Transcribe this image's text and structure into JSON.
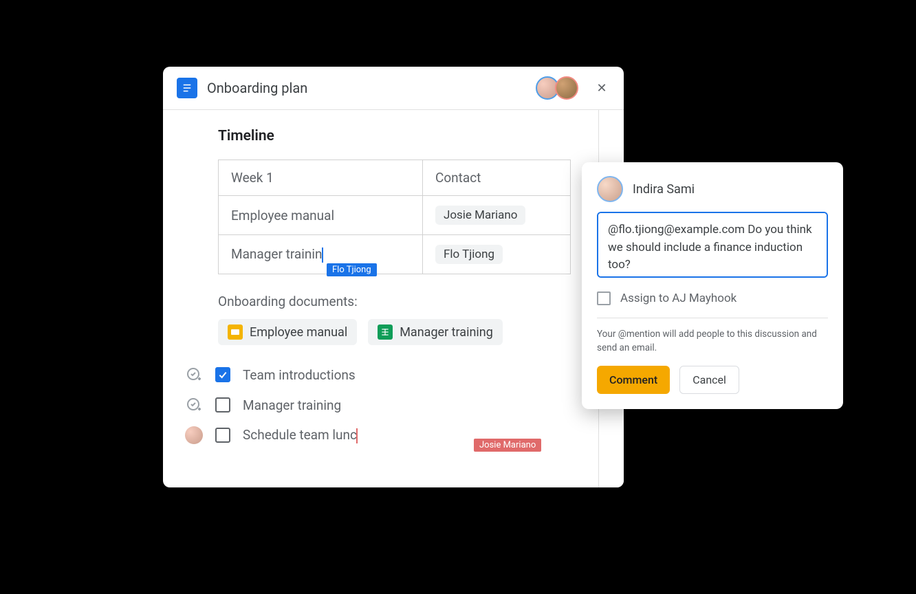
{
  "doc": {
    "title": "Onboarding plan",
    "section": "Timeline",
    "table": {
      "headers": [
        "Week 1",
        "Contact"
      ],
      "rows": [
        {
          "left": "Employee manual",
          "contact": "Josie Mariano"
        },
        {
          "left": "Manager trainin",
          "contact": "Flo Tjiong"
        }
      ]
    },
    "presence": {
      "blue": "Flo Tjiong",
      "red": "Josie Mariano"
    },
    "subheading": "Onboarding documents:",
    "docChips": [
      {
        "label": "Employee manual",
        "kind": "slides"
      },
      {
        "label": "Manager training",
        "kind": "sheets"
      }
    ],
    "checklist": [
      {
        "label": "Team introductions",
        "checked": true,
        "avatar": "task"
      },
      {
        "label": "Manager training",
        "checked": false,
        "avatar": "task"
      },
      {
        "label": "Schedule team lunc",
        "checked": false,
        "avatar": "person"
      }
    ]
  },
  "comment": {
    "author": "Indira Sami",
    "text": "@flo.tjiong@example.com Do you think we should include a finance induction too?",
    "assignLabel": "Assign to AJ Mayhook",
    "mentionNote": "Your @mention will add people to this discussion and send an email.",
    "primary": "Comment",
    "secondary": "Cancel"
  }
}
